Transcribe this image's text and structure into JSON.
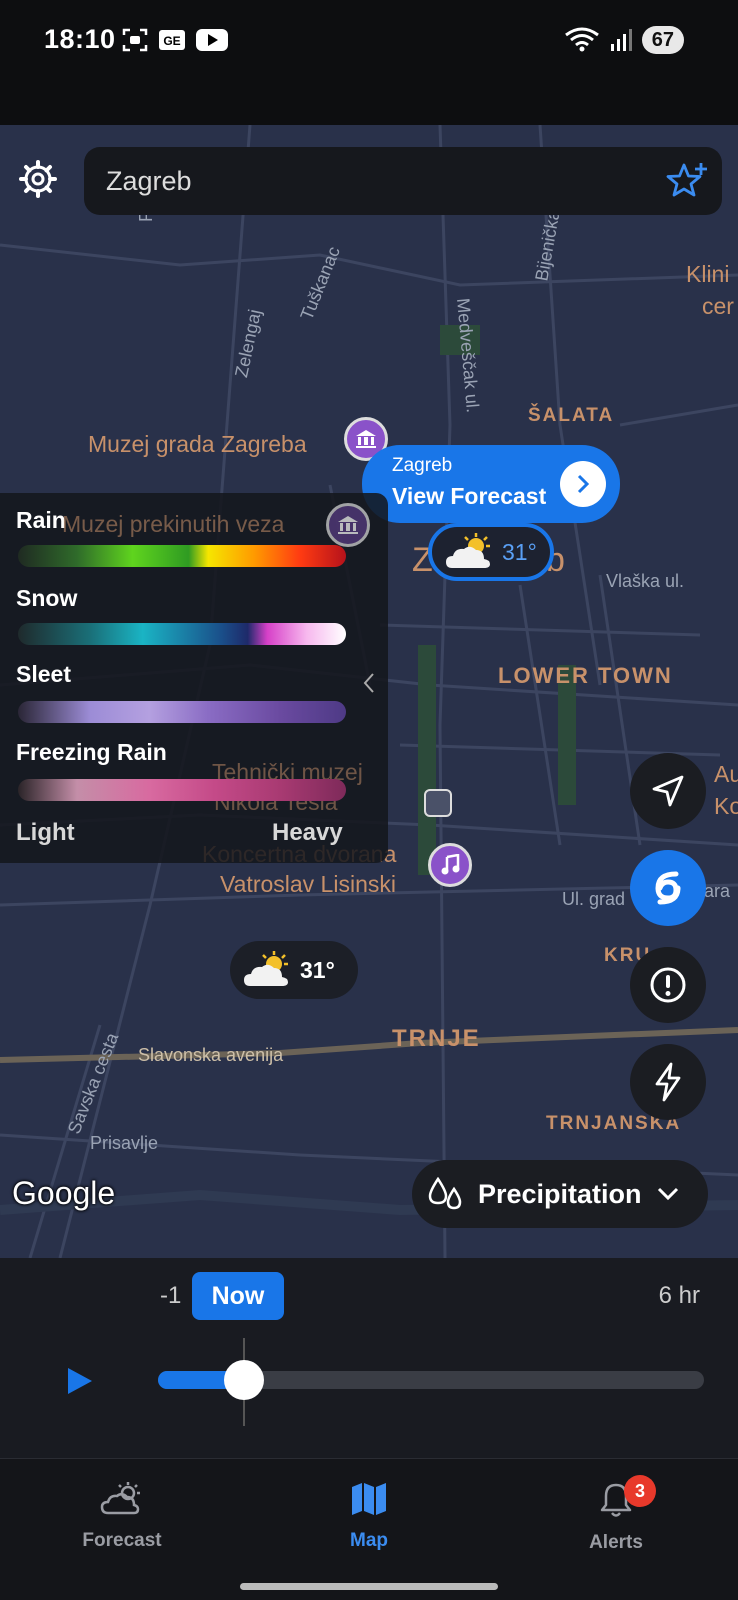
{
  "status_bar": {
    "time": "18:10",
    "battery": "67"
  },
  "search": {
    "value": "Zagreb"
  },
  "map": {
    "labels": {
      "muzej_grada": "Muzej grada Zagreba",
      "muzej_prekinutih": "Muzej prekinutih veza",
      "tehnicki_muzej": "Tehnički muzej",
      "nikola_tesla": "Nikola Tesla",
      "koncertna_1": "Koncertna dvorana",
      "koncertna_2": "Vatroslav Lisinski",
      "klini": "Klini",
      "cer": "cer",
      "au": "Au",
      "ko": "Ko",
      "zagreb_under_left": "Z",
      "zagreb_under_right": "b"
    },
    "districts": {
      "salata": "ŠALATA",
      "lower_town": "LOWER TOWN",
      "trnje": "TRNJE",
      "trnjanska": "TRNJANSKA",
      "kru": "KRU"
    },
    "streets": {
      "pant": "Pant",
      "tuskanac": "Tuškanac",
      "zelengaj": "Zelengaj",
      "medvescak": "Medveščak ul.",
      "bijenicka": "Bijenička",
      "vlaska": "Vlaška ul.",
      "ul_grad": "Ul. grad",
      "ara": "ara",
      "slavonska": "Slavonska avenija",
      "savska": "Savska cesta",
      "prisavlje": "Prisavlje"
    },
    "callout": {
      "place": "Zagreb",
      "action": "View Forecast"
    },
    "pin_temp": "31°",
    "pill_temp": "31°",
    "attribution": "Google"
  },
  "legend": {
    "items": [
      {
        "label": "Rain"
      },
      {
        "label": "Snow"
      },
      {
        "label": "Sleet"
      },
      {
        "label": "Freezing Rain"
      }
    ],
    "low_label": "Light",
    "high_label": "Heavy"
  },
  "layer_selector": {
    "label": "Precipitation"
  },
  "timeline": {
    "prev": "-1",
    "now": "Now",
    "end": "6 hr",
    "progress": 0.15
  },
  "bottom_nav": {
    "items": [
      {
        "label": "Forecast"
      },
      {
        "label": "Map"
      },
      {
        "label": "Alerts"
      }
    ],
    "alerts_badge": "3"
  },
  "colors": {
    "accent": "#1976e8",
    "map_bg": "#29314a",
    "label": "#c8916a",
    "badge": "#e8392b"
  }
}
